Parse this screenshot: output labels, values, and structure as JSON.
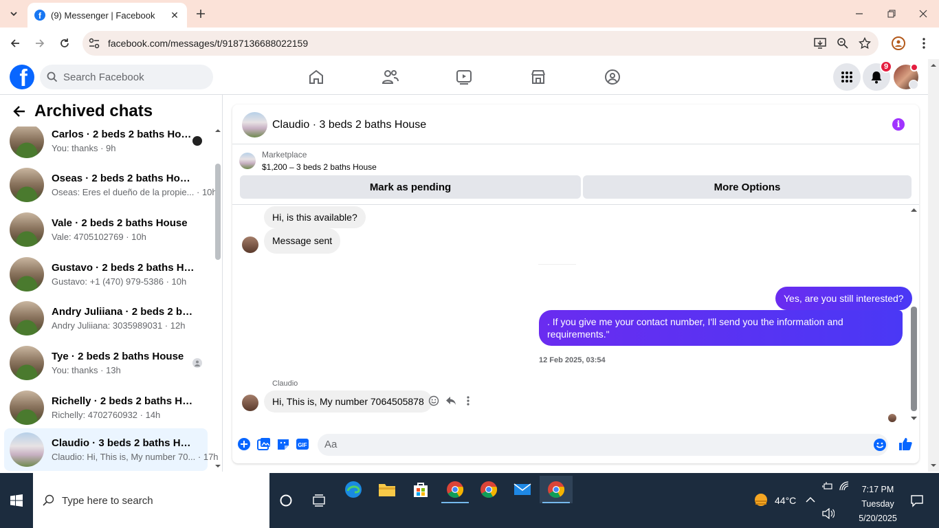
{
  "browser": {
    "tab_title": "(9) Messenger | Facebook",
    "url": "facebook.com/messages/t/9187136688022159"
  },
  "fb": {
    "search_placeholder": "Search Facebook",
    "notifications_count": "9"
  },
  "left": {
    "title": "Archived chats",
    "chats": [
      {
        "name": "Carlos · 2 beds 2 baths House",
        "last": "You: thanks · 9h"
      },
      {
        "name": "Oseas · 2 beds 2 baths House",
        "last": "Oseas: Eres el dueño de la propie... · 10h"
      },
      {
        "name": "Vale · 2 beds 2 baths House",
        "last": "Vale: 4705102769 · 10h"
      },
      {
        "name": "Gustavo · 2 beds 2 baths House",
        "last": "Gustavo: +1 (470) 979-5386 · 10h"
      },
      {
        "name": "Andry Juliiana · 2 beds 2 baths ...",
        "last": "Andry Juliiana: 3035989031 · 12h"
      },
      {
        "name": "Tye · 2 beds 2 baths House",
        "last": "You: thanks · 13h"
      },
      {
        "name": "Richelly · 2 beds 2 baths House",
        "last": "Richelly: 4702760932 · 14h"
      },
      {
        "name": "Claudio · 3 beds 2 baths House",
        "last": "Claudio: Hi, This is, My number 70... · 17h"
      }
    ]
  },
  "conversation": {
    "title": "Claudio · 3 beds 2 baths House",
    "marketplace_label": "Marketplace",
    "listing": "$1,200 – 3 beds 2 baths House",
    "pending_button": "Mark as pending",
    "more_button": "More Options",
    "messages": {
      "m1": "Hi, is this available?",
      "m2": "Message sent",
      "m3": "Yes, are you still interested?",
      "m4": ". If you give me your contact number, I'll send you the information and requirements.\"",
      "timestamp": "12 Feb 2025, 03:54",
      "sender": "Claudio",
      "m5": "Hi, This is, My number 7064505878"
    },
    "composer_placeholder": "Aa"
  },
  "taskbar": {
    "search_placeholder": "Type here to search",
    "temperature": "44°C",
    "time": "7:17 PM",
    "day": "Tuesday",
    "date": "5/20/2025"
  },
  "colors": {
    "fb_blue": "#0866ff",
    "outgoing_bubble": "#5b2dfe",
    "tab_bar": "#fbe2d8",
    "taskbar": "#1c2c3e"
  }
}
